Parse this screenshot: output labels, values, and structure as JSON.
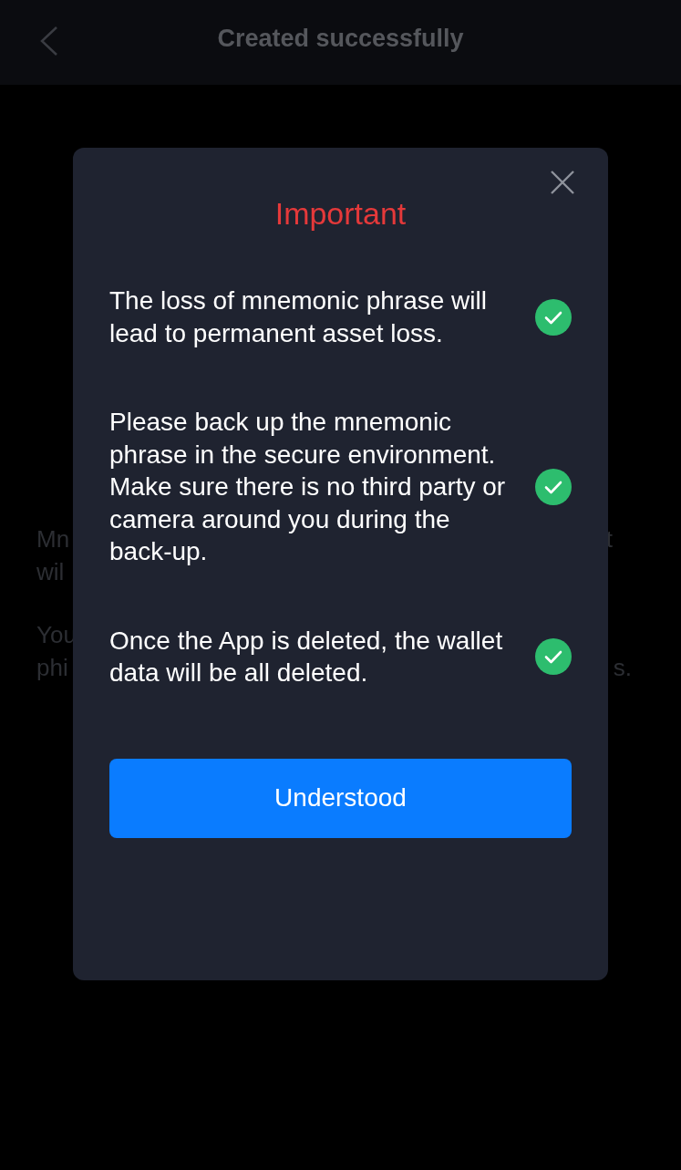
{
  "header": {
    "title": "Created successfully"
  },
  "background_text": [
    {
      "left": "Mn",
      "right": "t"
    },
    {
      "left": "wil"
    },
    {
      "left": "You"
    },
    {
      "left": "phi",
      "right": "s."
    }
  ],
  "dialog": {
    "title": "Important",
    "items": [
      {
        "text": "The loss of mnemonic phrase will lead to permanent asset loss.",
        "checked": true
      },
      {
        "text": "Please back up the mnemonic phrase in the secure environment.\nMake sure there is no third party or camera around you during the back-up.",
        "checked": true
      },
      {
        "text": "Once the App is deleted, the wallet data will be all deleted.",
        "checked": true
      }
    ],
    "button": "Understood"
  }
}
